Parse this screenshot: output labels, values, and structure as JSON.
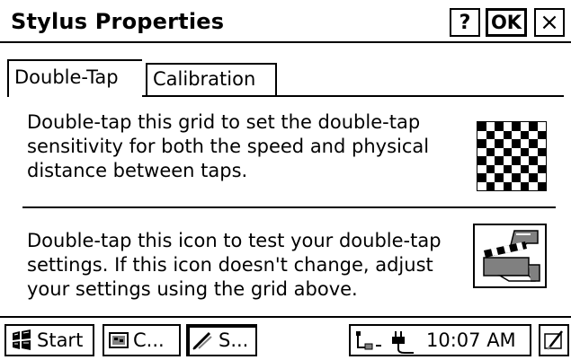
{
  "window": {
    "title": "Stylus Properties",
    "help_label": "?",
    "ok_label": "OK",
    "close_label": "×"
  },
  "tabs": [
    {
      "label": "Double-Tap",
      "active": true
    },
    {
      "label": "Calibration",
      "active": false
    }
  ],
  "panel": {
    "grid_instruction": "Double-tap this grid to set the double-tap sensitivity for both the speed and physical distance between taps.",
    "icon_instruction": "Double-tap this icon to test your double-tap settings. If this icon doesn't change, adjust your settings using the grid above.",
    "grid_icon": "checkerboard-grid-icon",
    "test_icon": "clapperboard-test-icon"
  },
  "taskbar": {
    "start_label": "Start",
    "task1_label": "C...",
    "task2_label": "S...",
    "clock": "10:07 AM",
    "task1_icon": "control-panel-icon",
    "task2_icon": "stylus-icon",
    "tray_icons": [
      "connection-icon",
      "power-plug-icon"
    ],
    "desktop_icon": "show-desktop-icon"
  }
}
